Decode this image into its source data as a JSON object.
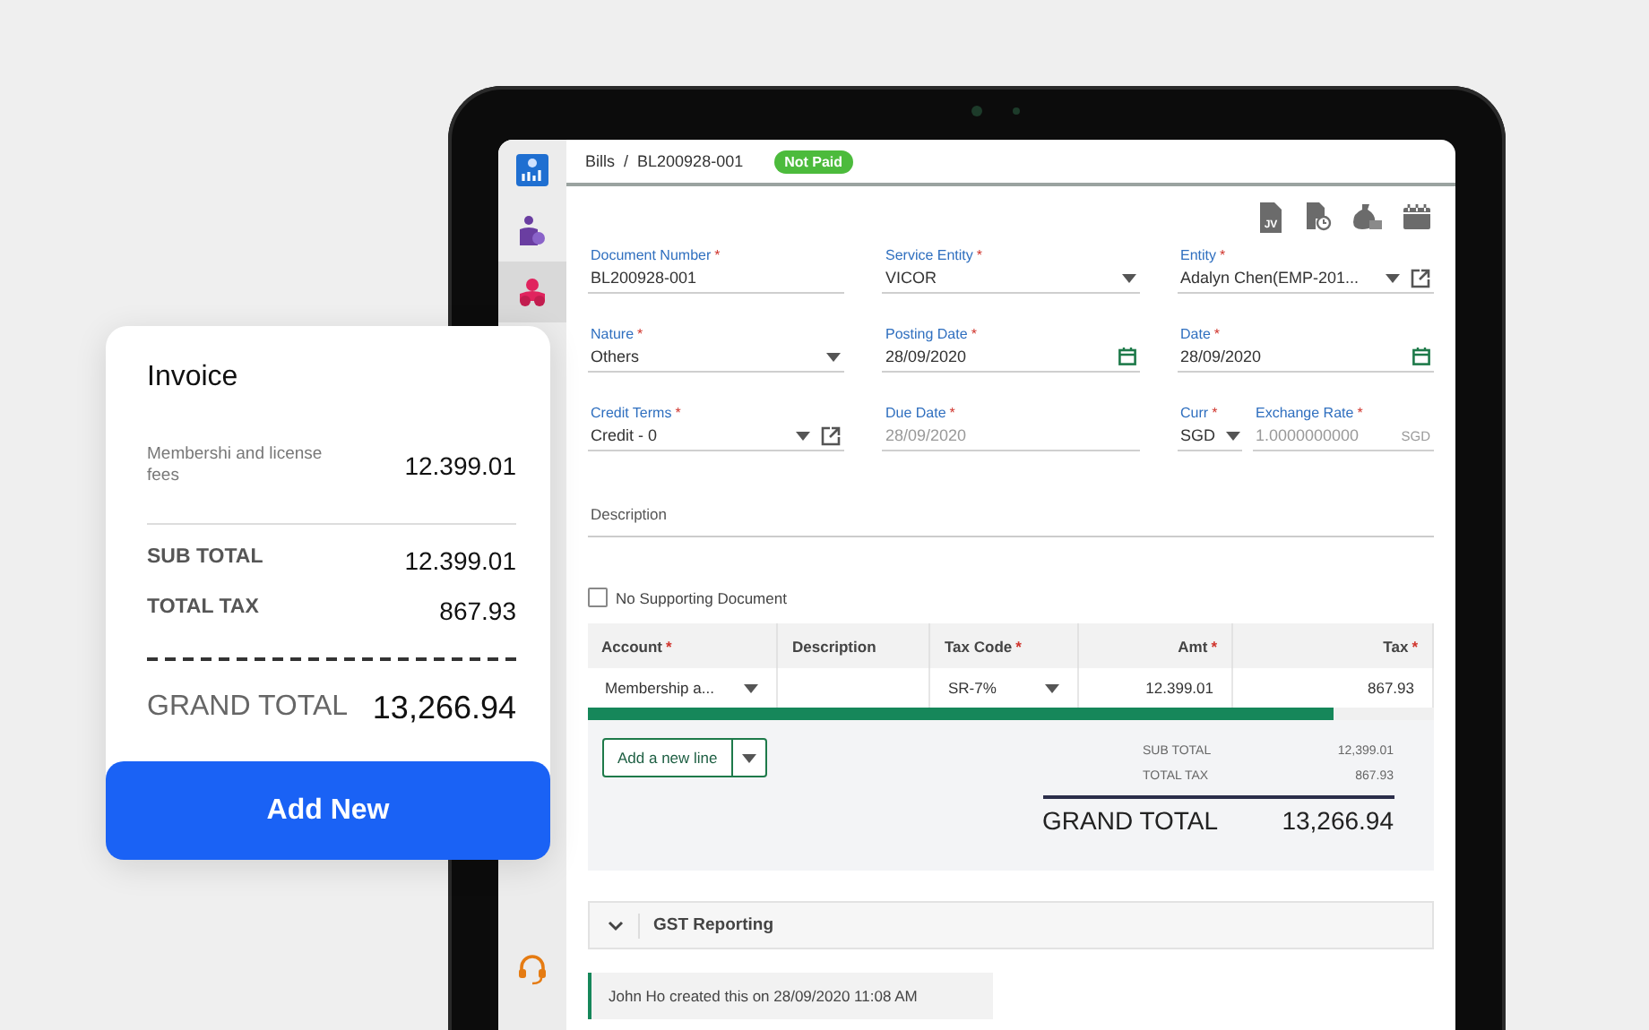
{
  "sidebar": {
    "items": [
      {
        "kind": "logo",
        "selected": false
      },
      {
        "kind": "person",
        "selected": false
      },
      {
        "kind": "team",
        "selected": true
      },
      {
        "kind": "support",
        "selected": false
      }
    ]
  },
  "header": {
    "breadcrumb": [
      "Bills",
      "/",
      "BL200928-001"
    ],
    "badge": {
      "label": "Not Paid",
      "color": "#4cbb3c"
    }
  },
  "toolbar": {
    "items": [
      {
        "kind": "jv",
        "label": "JV"
      },
      {
        "kind": "doc-clock"
      },
      {
        "kind": "money-bag"
      },
      {
        "kind": "calendar"
      }
    ]
  },
  "fields": [
    {
      "label": "Document Number",
      "mark": "*",
      "value": "BL200928-001",
      "kind": "text"
    },
    {
      "label": "Service Entity",
      "mark": "*",
      "value": "VICOR",
      "kind": "select"
    },
    {
      "label": "Entity",
      "mark": "*",
      "value": "Adalyn Chen(EMP-201...",
      "kind": "select",
      "link": true
    },
    {
      "label": "Nature",
      "mark": "*",
      "value": "Others",
      "kind": "select"
    },
    {
      "label": "Posting Date",
      "mark": "*",
      "value": "28/09/2020",
      "kind": "date"
    },
    {
      "label": "Date",
      "mark": "*",
      "value": "28/09/2020",
      "kind": "date"
    },
    {
      "label": "Credit Terms",
      "mark": "*",
      "value": "Credit - 0",
      "kind": "select",
      "link": true
    },
    {
      "label": "Due Date",
      "mark": "*",
      "value": "28/09/2020",
      "kind": "readonly"
    },
    {
      "kind": "currency",
      "currency": {
        "label": "Curr",
        "mark": "*",
        "value": "SGD"
      },
      "rate": {
        "label": "Exchange Rate",
        "mark": "*",
        "value": "1.0000000000",
        "unit": "SGD"
      }
    }
  ],
  "description": {
    "placeholder": "Description"
  },
  "no_supporting_document": {
    "label": "No Supporting Document",
    "checked": false
  },
  "table": {
    "columns": [
      {
        "label": "Account",
        "mark": "*"
      },
      {
        "label": "Description"
      },
      {
        "label": "Tax Code",
        "mark": "*"
      },
      {
        "label": "Amt",
        "mark": "*"
      },
      {
        "label": "Tax",
        "mark": "*"
      }
    ],
    "rows": [
      {
        "cells": [
          {
            "kind": "select",
            "value": "Membership a..."
          },
          {
            "kind": "empty"
          },
          {
            "kind": "select",
            "value": "SR-7%"
          },
          {
            "kind": "number",
            "value": "12.399.01"
          },
          {
            "kind": "number",
            "value": "867.93"
          }
        ]
      }
    ]
  },
  "add_line_button": {
    "label": "Add a new line"
  },
  "totals": {
    "sub_total": {
      "label": "SUB TOTAL",
      "value": "12,399.01"
    },
    "total_tax": {
      "label": "TOTAL TAX",
      "value": "867.93"
    },
    "grand_total": {
      "label": "GRAND TOTAL",
      "value": "13,266.94"
    }
  },
  "section": {
    "title": "GST Reporting"
  },
  "activity": {
    "text": "John Ho created this on 28/09/2020 11:08 AM"
  },
  "invoice_card": {
    "title": "Invoice",
    "item": {
      "label": "Membershi and license fees",
      "amount": "12.399.01"
    },
    "sub_total": {
      "label": "SUB TOTAL",
      "value": "12.399.01"
    },
    "total_tax": {
      "label": "TOTAL TAX",
      "value": "867.93"
    },
    "grand_total": {
      "label": "GRAND TOTAL",
      "value": "13,266.94"
    },
    "button": "Add New"
  }
}
